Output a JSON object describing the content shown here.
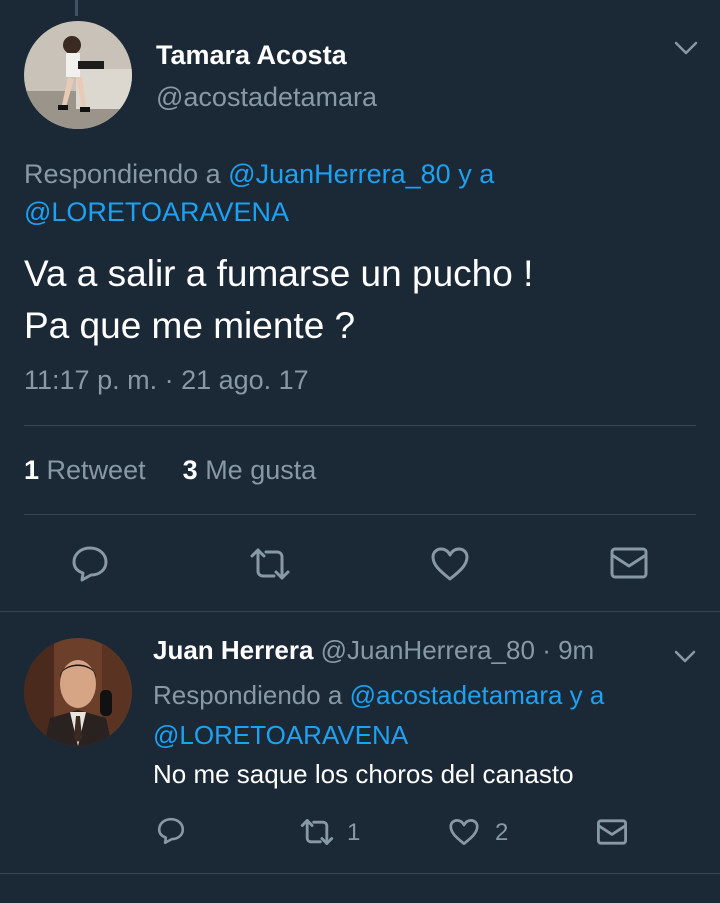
{
  "main_tweet": {
    "display_name": "Tamara Acosta",
    "handle": "@acostadetamara",
    "replying_prefix": "Respondiendo a ",
    "replying_user1": "@JuanHerrera_80",
    "replying_joiner": " y a",
    "replying_user2": "@LORETOARAVENA",
    "text_line1": "Va a salir a fumarse un pucho !",
    "text_line2": "Pa que me miente ?",
    "timestamp": "11:17 p. m. · 21 ago. 17",
    "retweet_count": "1",
    "retweet_label": "Retweet",
    "like_count": "3",
    "like_label": "Me gusta"
  },
  "reply_tweet": {
    "display_name": "Juan Herrera",
    "handle": "@JuanHerrera_80",
    "time": "· 9m",
    "replying_prefix": "Respondiendo a ",
    "replying_user1": "@acostadetamara",
    "replying_joiner": " y a",
    "replying_user2": "@LORETOARAVENA",
    "text": "No me saque los choros del canasto",
    "retweet_count": "1",
    "like_count": "2"
  },
  "colors": {
    "background": "#1b2836",
    "link": "#1da1f2",
    "muted": "#8899a6",
    "divider": "#38444d"
  },
  "icons": [
    "reply-icon",
    "retweet-icon",
    "like-icon",
    "message-icon",
    "chevron-down-icon"
  ]
}
